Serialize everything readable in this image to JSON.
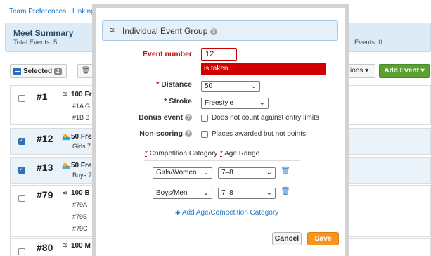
{
  "nav": {
    "links": [
      "Team Preferences",
      "Linking"
    ]
  },
  "summary": {
    "title": "Meet Summary",
    "total_events": "Total Events: 5",
    "right_text": "Events: 0"
  },
  "toolbar": {
    "selected_label": "Selected",
    "selected_count": "2",
    "options_label": "ions",
    "add_event_label": "Add Event"
  },
  "events": [
    {
      "checked": false,
      "number": "#1",
      "name": "100 Fr",
      "subs": [
        "#1A G",
        "#1B B"
      ]
    },
    {
      "checked": true,
      "number": "#12",
      "name": "50 Fre",
      "subs": [
        "Girls 7"
      ]
    },
    {
      "checked": true,
      "number": "#13",
      "name": "50 Fre",
      "subs": [
        "Boys 7"
      ]
    },
    {
      "checked": false,
      "number": "#79",
      "name": "100 B",
      "subs": [
        "#79A",
        "#79B",
        "#79C"
      ]
    },
    {
      "checked": false,
      "number": "#80",
      "name": "100 M",
      "subs": []
    }
  ],
  "modal": {
    "title": "Individual Event Group",
    "event_number_label": "Event number",
    "event_number_value": "12",
    "error_text": "is taken",
    "distance_label": "Distance",
    "distance_value": "50",
    "stroke_label": "Stroke",
    "stroke_value": "Freestyle",
    "bonus_label": "Bonus event",
    "bonus_text": "Does not count against entry limits",
    "nonscoring_label": "Non-scoring",
    "nonscoring_text": "Places awarded but not points",
    "col_competition": "Competition Category",
    "col_age": "Age Range",
    "categories": [
      {
        "competition": "Girls/Women",
        "age": "7–8"
      },
      {
        "competition": "Boys/Men",
        "age": "7–8"
      }
    ],
    "add_category_label": "Add Age/Competition Category",
    "cancel_label": "Cancel",
    "save_label": "Save"
  },
  "colors": {
    "accent_blue": "#2a78c0",
    "error_red": "#d00000",
    "save_orange": "#f5941f",
    "add_green": "#5aa132"
  }
}
